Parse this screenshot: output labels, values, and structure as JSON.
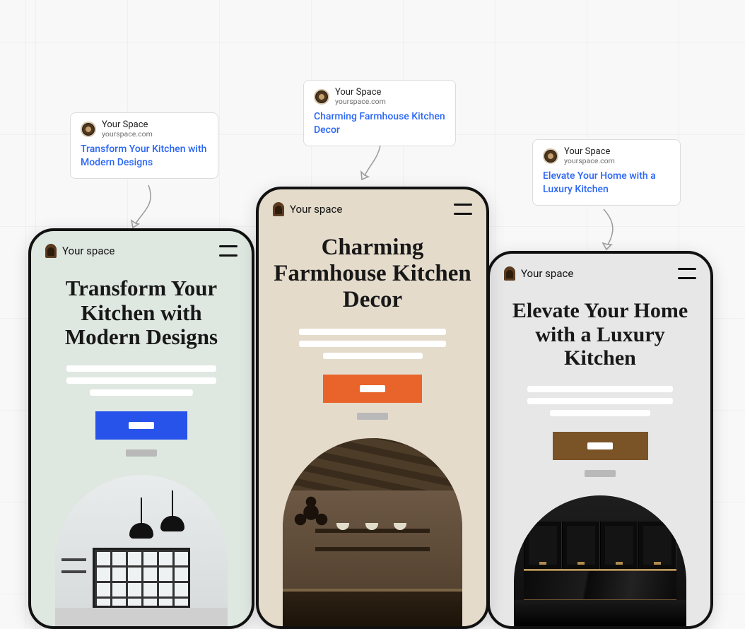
{
  "meta_cards": {
    "site_name": "Your Space",
    "domain": "yourspace.com",
    "a": {
      "title": "Transform Your Kitchen with Modern Designs"
    },
    "b": {
      "title": "Charming Farmhouse Kitchen Decor"
    },
    "c": {
      "title": "Elevate Your Home with a Luxury Kitchen"
    }
  },
  "phones": {
    "brand_label": "Your space",
    "a": {
      "hero_title": "Transform Your Kitchen with Modern Designs",
      "cta_color": "#2753ea",
      "bg_color": "#dfe7e1"
    },
    "b": {
      "hero_title": "Charming Farmhouse Kitchen Decor",
      "cta_color": "#e8642b",
      "bg_color": "#e4dbcb"
    },
    "c": {
      "hero_title": "Elevate Your Home with a Luxury Kitchen",
      "cta_color": "#7a5327",
      "bg_color": "#e7e7e7"
    }
  }
}
